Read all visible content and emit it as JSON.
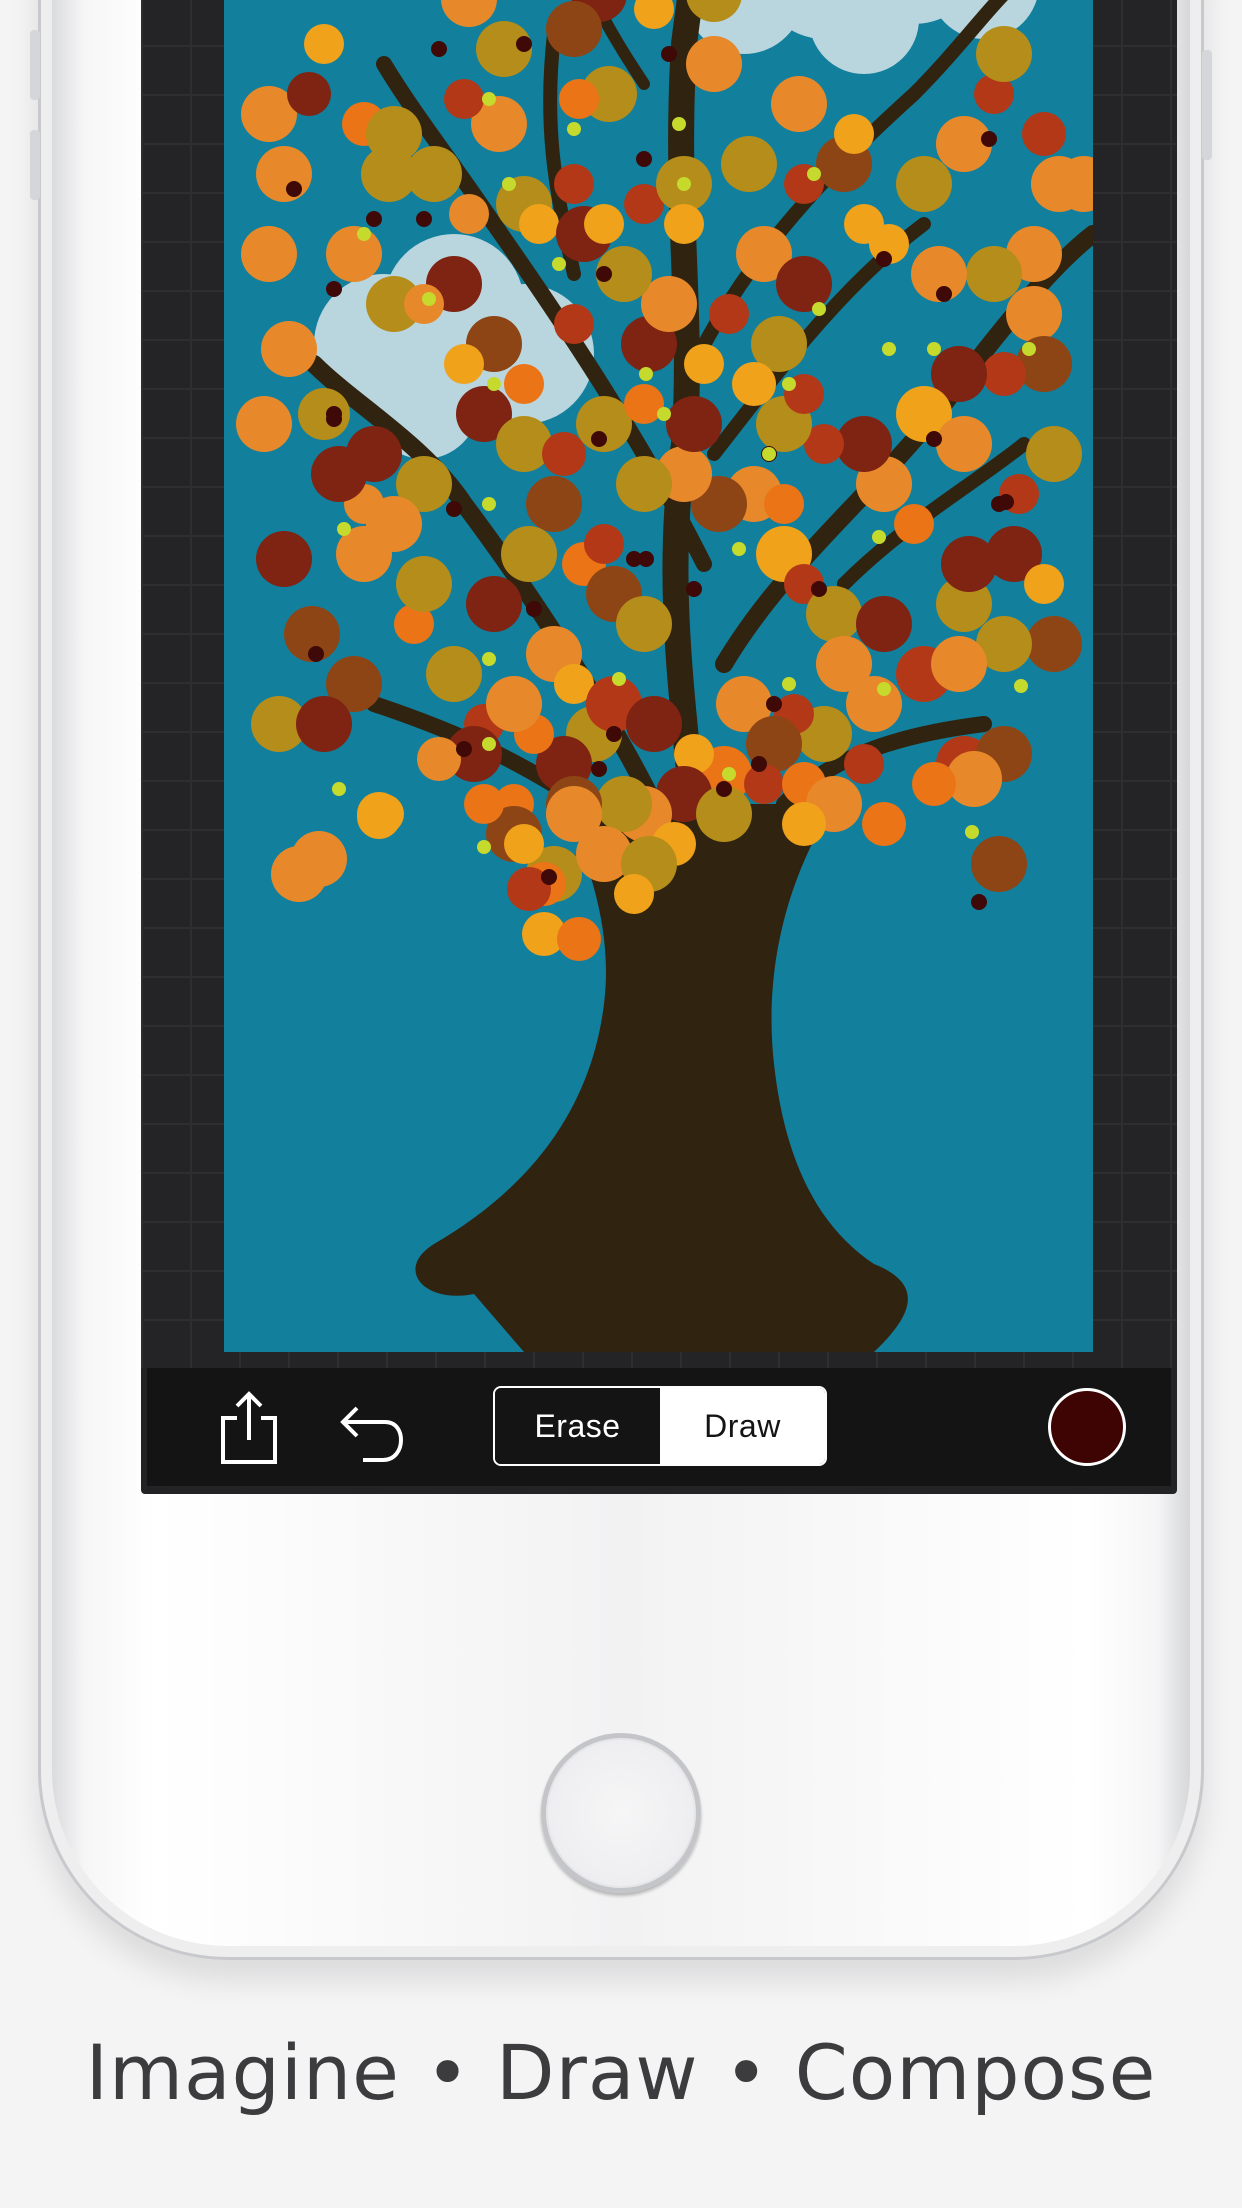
{
  "toolbar": {
    "share_icon": "share-icon",
    "undo_icon": "undo-icon",
    "mode_options": [
      "Erase",
      "Draw"
    ],
    "selected_mode": "Draw",
    "current_color": "#3d0403"
  },
  "canvas": {
    "background_color": "#127f9c",
    "subject": "autumn tree with clouds"
  },
  "tagline": "Imagine • Draw • Compose",
  "colors": {
    "page_background": "#f4f4f5",
    "leaf_colors": [
      "#e7892a",
      "#f0a21b",
      "#b48d1a",
      "#7f2312",
      "#8d4515",
      "#ea7416",
      "#b33818",
      "#c6d92d",
      "#3e0907"
    ],
    "trunk": "#302310",
    "cloud": "#b9d5de"
  }
}
